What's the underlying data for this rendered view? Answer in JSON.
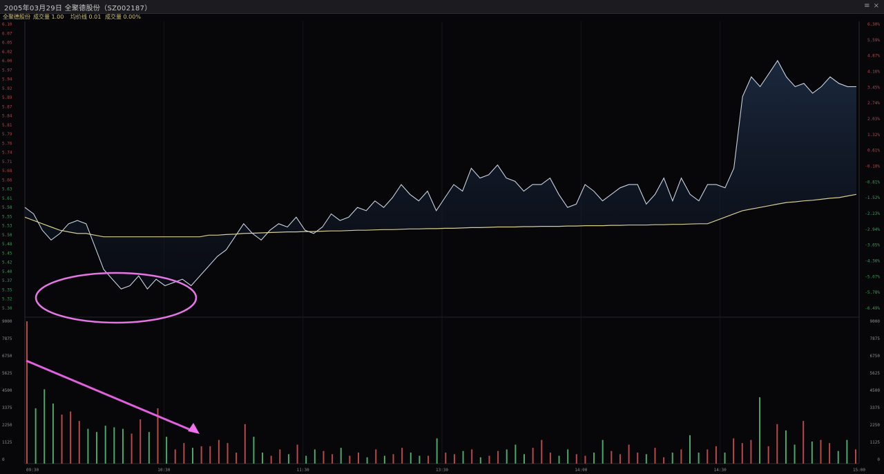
{
  "window": {
    "title": "2005年03月29日  全聚德股份（SZ002187）",
    "menu_glyph": "≡ ×"
  },
  "info": {
    "item1": "全聚德股份",
    "item2": "成交量 1.00",
    "item3": "均价线 0.01",
    "item4": "成交量 0.00%"
  },
  "chart_data": {
    "type": "line",
    "price": {
      "ylim": [
        5.2,
        6.1
      ],
      "left_ticks": [
        "6.10",
        "6.07",
        "6.05",
        "6.02",
        "6.00",
        "5.97",
        "5.94",
        "5.92",
        "5.89",
        "5.87",
        "5.84",
        "5.81",
        "5.79",
        "5.76",
        "5.74",
        "5.71",
        "5.68",
        "5.66",
        "5.63",
        "5.61",
        "5.58",
        "5.55",
        "5.53",
        "5.50",
        "5.48",
        "5.45",
        "5.42",
        "5.40",
        "5.37",
        "5.35",
        "5.32",
        "5.30"
      ],
      "right_ticks": [
        "6.30%",
        "5.59%",
        "4.87%",
        "4.16%",
        "3.45%",
        "2.74%",
        "2.03%",
        "1.32%",
        "0.61%",
        "-0.10%",
        "-0.81%",
        "-1.52%",
        "-2.23%",
        "-2.94%",
        "-3.65%",
        "-4.36%",
        "-5.07%",
        "-5.78%",
        "-6.49%"
      ],
      "series": [
        {
          "role": "price",
          "color": "#c9d3e0",
          "values": [
            5.53,
            5.51,
            5.46,
            5.43,
            5.45,
            5.48,
            5.49,
            5.48,
            5.41,
            5.34,
            5.31,
            5.28,
            5.29,
            5.32,
            5.28,
            5.31,
            5.29,
            5.3,
            5.31,
            5.29,
            5.32,
            5.35,
            5.38,
            5.4,
            5.44,
            5.48,
            5.45,
            5.43,
            5.46,
            5.48,
            5.47,
            5.5,
            5.46,
            5.45,
            5.47,
            5.51,
            5.49,
            5.5,
            5.53,
            5.52,
            5.55,
            5.53,
            5.56,
            5.6,
            5.57,
            5.55,
            5.58,
            5.52,
            5.56,
            5.6,
            5.58,
            5.65,
            5.62,
            5.63,
            5.66,
            5.62,
            5.61,
            5.58,
            5.6,
            5.6,
            5.62,
            5.57,
            5.53,
            5.54,
            5.6,
            5.58,
            5.55,
            5.57,
            5.59,
            5.6,
            5.6,
            5.54,
            5.57,
            5.62,
            5.55,
            5.62,
            5.57,
            5.55,
            5.6,
            5.6,
            5.59,
            5.65,
            5.87,
            5.93,
            5.9,
            5.94,
            5.98,
            5.93,
            5.9,
            5.91,
            5.88,
            5.9,
            5.93,
            5.91,
            5.9,
            5.9
          ]
        },
        {
          "role": "average",
          "color": "#d8cf8a",
          "values": [
            5.5,
            5.49,
            5.48,
            5.47,
            5.46,
            5.455,
            5.45,
            5.45,
            5.445,
            5.44,
            5.44,
            5.44,
            5.44,
            5.44,
            5.44,
            5.44,
            5.44,
            5.44,
            5.44,
            5.44,
            5.44,
            5.445,
            5.445,
            5.447,
            5.448,
            5.45,
            5.451,
            5.452,
            5.453,
            5.454,
            5.455,
            5.455,
            5.456,
            5.456,
            5.457,
            5.458,
            5.458,
            5.459,
            5.46,
            5.46,
            5.461,
            5.462,
            5.462,
            5.463,
            5.464,
            5.464,
            5.465,
            5.465,
            5.466,
            5.466,
            5.467,
            5.468,
            5.468,
            5.469,
            5.47,
            5.47,
            5.47,
            5.471,
            5.471,
            5.472,
            5.472,
            5.472,
            5.473,
            5.473,
            5.474,
            5.474,
            5.474,
            5.475,
            5.475,
            5.476,
            5.476,
            5.476,
            5.477,
            5.477,
            5.478,
            5.478,
            5.479,
            5.48,
            5.48,
            5.49,
            5.5,
            5.51,
            5.52,
            5.525,
            5.53,
            5.535,
            5.54,
            5.545,
            5.547,
            5.55,
            5.552,
            5.555,
            5.558,
            5.56,
            5.565,
            5.57
          ]
        }
      ]
    },
    "volume": {
      "ylim": [
        0,
        9000
      ],
      "left_ticks": [
        "9000",
        "7875",
        "6750",
        "5625",
        "4500",
        "3375",
        "2250",
        "1125",
        "0"
      ],
      "right_ticks": [
        "9000",
        "7875",
        "6750",
        "5625",
        "4500",
        "3375",
        "2250",
        "1125",
        "0"
      ],
      "values": [
        9000,
        3500,
        4700,
        3800,
        3100,
        3300,
        2700,
        2200,
        2000,
        2400,
        2300,
        2200,
        1900,
        2800,
        2000,
        3500,
        1700,
        900,
        1300,
        1000,
        1100,
        1100,
        1500,
        1300,
        700,
        2500,
        1700,
        700,
        500,
        900,
        600,
        1200,
        500,
        900,
        800,
        600,
        1000,
        500,
        700,
        400,
        900,
        500,
        600,
        1000,
        700,
        500,
        500,
        1600,
        700,
        600,
        800,
        900,
        400,
        500,
        800,
        900,
        1200,
        600,
        1000,
        1500,
        700,
        500,
        900,
        600,
        500,
        700,
        1500,
        800,
        600,
        1200,
        700,
        600,
        1000,
        400,
        700,
        900,
        1800,
        700,
        900,
        1100,
        700,
        1600,
        1300,
        1500,
        4200,
        1100,
        2500,
        2100,
        1200,
        2700,
        1400,
        1500,
        1300,
        800,
        1500,
        900
      ]
    },
    "time_ticks": [
      "09:30",
      "10:30",
      "11:30",
      "13:30",
      "14:00",
      "14:30",
      "15:00"
    ]
  }
}
